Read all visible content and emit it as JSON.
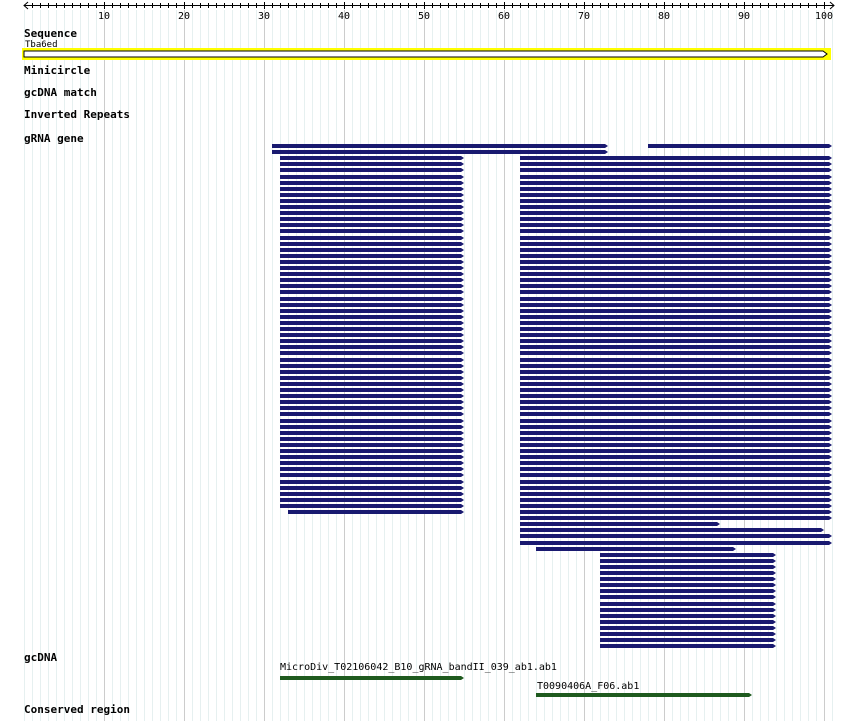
{
  "ruler": {
    "start": 0,
    "end": 101,
    "ticks": [
      "10",
      "20",
      "30",
      "40",
      "50",
      "60",
      "70",
      "80",
      "90",
      "100"
    ]
  },
  "tracks": {
    "sequence": {
      "title": "Sequence",
      "name": "Tba6ed"
    },
    "minicircle": "Minicircle",
    "gcdna_match": "gcDNA match",
    "inverted_repeats": "Inverted Repeats",
    "grna_gene": "gRNA gene",
    "gcdna": "gcDNA",
    "conserved_region": "Conserved region"
  },
  "colors": {
    "grna": "#191970",
    "gcdna": "#1e5a1e",
    "sequence_fill": "#ffff00",
    "grid": "#e6f0f0",
    "grid_major": "#cccccc"
  },
  "grna_features": [
    {
      "row": 0,
      "segments": [
        [
          31,
          73
        ]
      ]
    },
    {
      "row": 0,
      "segments": [
        [
          78,
          101
        ]
      ]
    },
    {
      "row": 1,
      "segments": [
        [
          31,
          73
        ]
      ]
    },
    {
      "group": "a",
      "from_row": 2,
      "to_row": 59,
      "segments": [
        [
          32,
          55
        ],
        [
          62,
          101
        ]
      ]
    },
    {
      "group": "b",
      "row": 60,
      "segments": [
        [
          33,
          55
        ]
      ]
    },
    {
      "group": "c",
      "from_row": 60,
      "to_row": 61,
      "segments": [
        [
          62,
          101
        ]
      ]
    },
    {
      "group": "d",
      "row": 62,
      "segments": [
        [
          62,
          87
        ]
      ]
    },
    {
      "group": "e",
      "row": 63,
      "segments": [
        [
          62,
          100
        ]
      ]
    },
    {
      "group": "f",
      "from_row": 64,
      "to_row": 65,
      "segments": [
        [
          62,
          101
        ]
      ]
    },
    {
      "group": "g",
      "row": 66,
      "segments": [
        [
          64,
          89
        ]
      ]
    },
    {
      "group": "h",
      "from_row": 67,
      "to_row": 82,
      "segments": [
        [
          72,
          94
        ]
      ]
    }
  ],
  "gcdna_features": [
    {
      "label": "MicroDiv_T02106042_B10_gRNA_bandII_039_ab1.ab1",
      "start": 32,
      "end": 55
    },
    {
      "label": "T0090406A_F06.ab1",
      "start": 64,
      "end": 91
    }
  ]
}
